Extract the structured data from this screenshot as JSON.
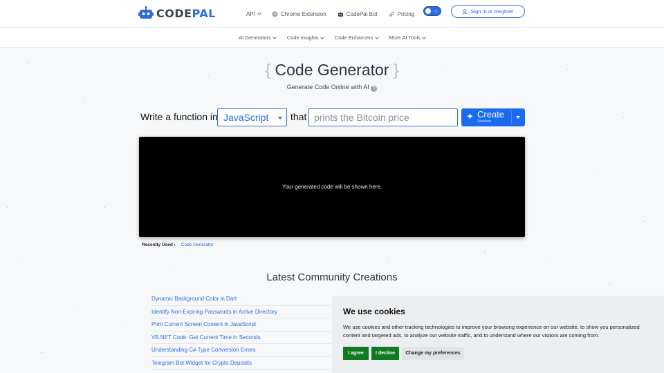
{
  "nav": {
    "logo_code": "CODE",
    "logo_pal": "PAL",
    "links": [
      {
        "label": "API",
        "icon": "chevron-down-icon"
      },
      {
        "label": "Chrome Extension",
        "icon": "chrome-icon"
      },
      {
        "label": "CodePal Bot",
        "icon": "bot-icon"
      },
      {
        "label": "Pricing",
        "icon": "rocket-icon"
      }
    ],
    "theme_toggle_icon": "sun-icon",
    "signin_label": "Sign In or Register"
  },
  "subnav": {
    "items": [
      "AI Generators",
      "Code Insights",
      "Code Enhancers",
      "More AI Tools"
    ]
  },
  "hero": {
    "title": "Code Generator",
    "subtitle": "Generate Code Online with AI"
  },
  "prompt": {
    "label_prefix": "Write a function in",
    "language": "JavaScript",
    "label_mid": "that",
    "placeholder": "prints the Bitcoin price",
    "create_label": "Create",
    "create_mode": "Standard"
  },
  "output": {
    "placeholder": "Your generated code will be shown here."
  },
  "recent": {
    "label": "Recently Used ›",
    "link": "Code Generator"
  },
  "community": {
    "title": "Latest Community Creations",
    "items": [
      "Dynamic Background Color in Dart",
      "Identify Non-Expiring Passwords in Active Directory",
      "Print Current Screen Content in JavaScript",
      "VB.NET Code: Get Current Time in Seconds",
      "Understanding C# Type Conversion Errors",
      "Telegram Bot Widget for Crypto Deposits"
    ]
  },
  "cookie": {
    "title": "We use cookies",
    "text": "We use cookies and other tracking technologies to improve your browsing experience on our website, to show you personalized content and targeted ads, to analyze our website traffic, and to understand where our visitors are coming from.",
    "agree": "I agree",
    "decline": "I decline",
    "prefs": "Change my preferences"
  },
  "colors": {
    "accent": "#2d6cdf",
    "button_blue": "#1a6bf0",
    "cookie_green": "#0f7a1f",
    "output_bg": "#000000"
  }
}
